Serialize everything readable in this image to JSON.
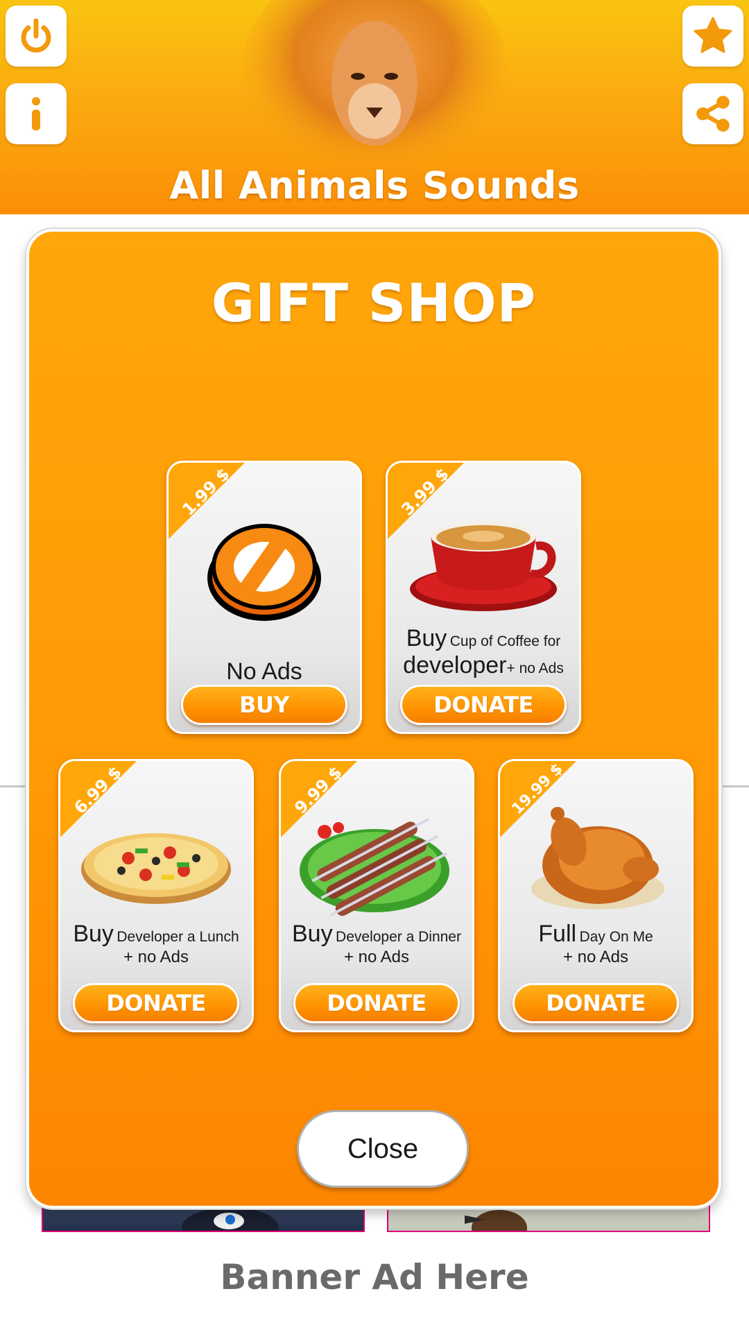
{
  "app": {
    "title": "All Animals Sounds",
    "accent": "#ff9a04",
    "header_icons": [
      "power-icon",
      "info-icon",
      "star-icon",
      "share-icon"
    ]
  },
  "dialog": {
    "title": "GIFT SHOP",
    "close_label": "Close",
    "items": [
      {
        "price": "1.99 $",
        "big": "No Ads",
        "small": "",
        "line2_big": "",
        "line2_small": "",
        "button": "BUY",
        "icon": "no-ads-icon"
      },
      {
        "price": "3.99 $",
        "big": "Buy",
        "small": "Cup of Coffee for",
        "line2_big": "developer",
        "line2_small": "+ no Ads",
        "button": "DONATE",
        "icon": "coffee-cup-icon"
      },
      {
        "price": "6.99 $",
        "big": "Buy",
        "small": "Developer a Lunch",
        "line2_big": "",
        "line2_small": "+ no Ads",
        "button": "DONATE",
        "icon": "pizza-icon"
      },
      {
        "price": "9.99 $",
        "big": "Buy",
        "small": "Developer a Dinner",
        "line2_big": "",
        "line2_small": "+ no Ads",
        "button": "DONATE",
        "icon": "kebab-icon"
      },
      {
        "price": "19.99 $",
        "big": "Full",
        "small": "Day On Me",
        "line2_big": "",
        "line2_small": "+ no Ads",
        "button": "DONATE",
        "icon": "roast-chicken-icon"
      }
    ]
  },
  "banner": {
    "label": "Banner Ad Here"
  }
}
